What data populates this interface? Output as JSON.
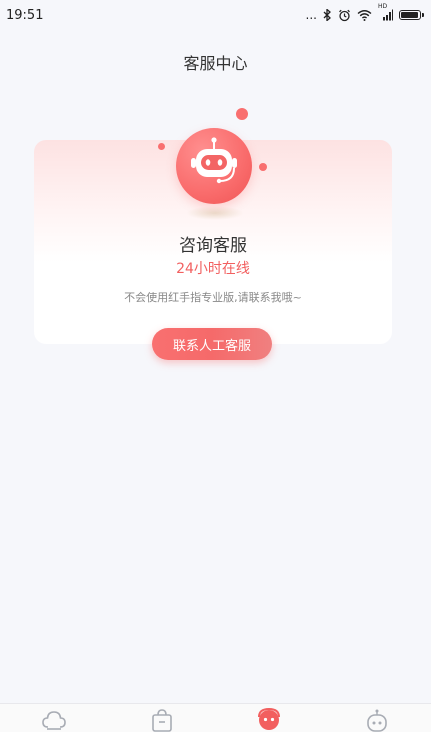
{
  "status_bar": {
    "time": "19:51",
    "dots": "...",
    "hd_label": "HD"
  },
  "header": {
    "title": "客服中心"
  },
  "card": {
    "title": "咨询客服",
    "online": "24小时在线",
    "description": "不会使用红手指专业版,请联系我哦~"
  },
  "actions": {
    "contact_label": "联系人工客服"
  },
  "colors": {
    "accent": "#f26060",
    "button": "#f56a6a",
    "background": "#f6f7fb"
  },
  "tabs": [
    {
      "icon": "cloud-icon",
      "active": false
    },
    {
      "icon": "shopping-bag-icon",
      "active": false
    },
    {
      "icon": "customer-service-icon",
      "active": true
    },
    {
      "icon": "robot-profile-icon",
      "active": false
    }
  ]
}
